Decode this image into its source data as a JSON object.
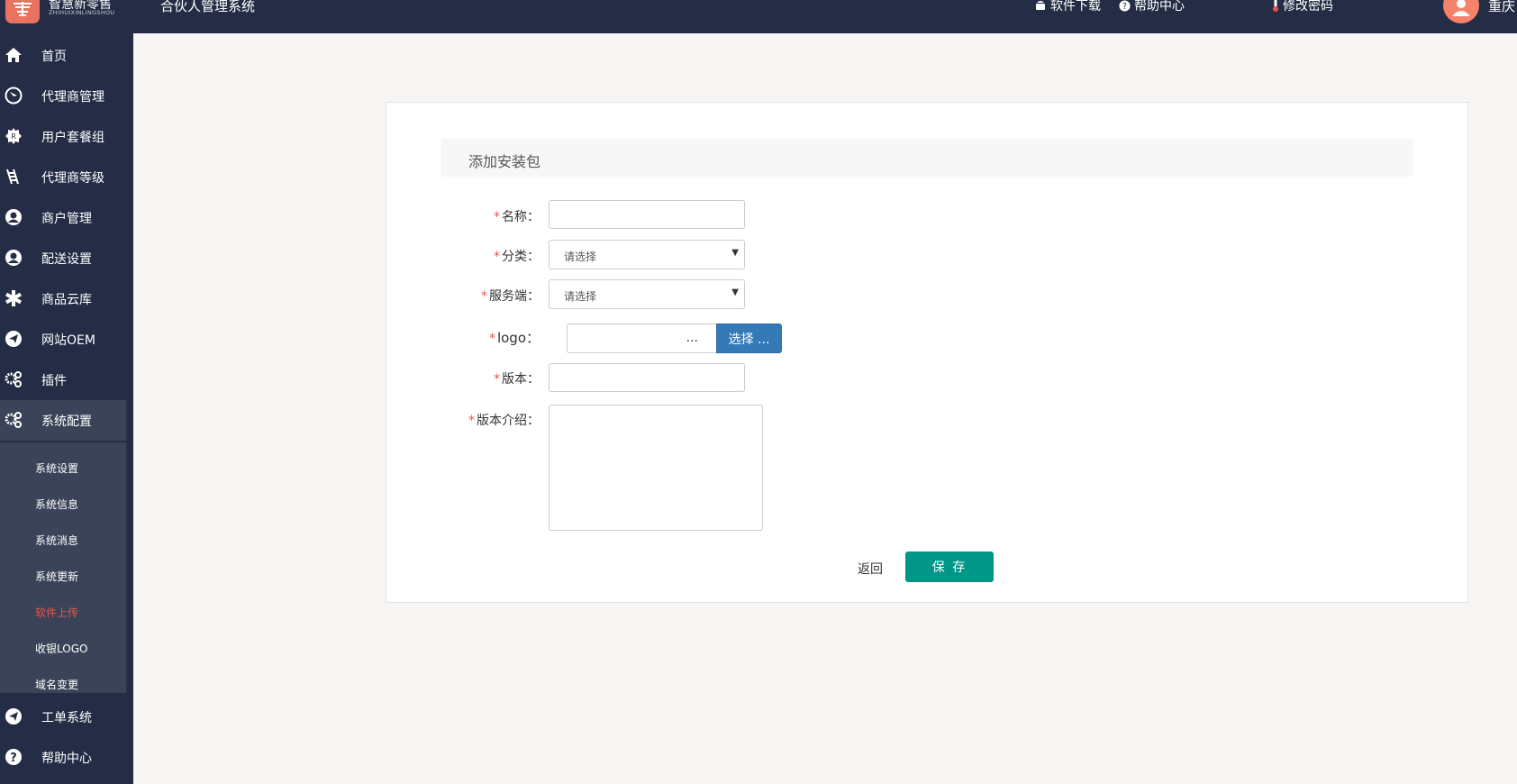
{
  "header": {
    "logo_cn": "智慧新零售",
    "logo_en": "ZHIHUIXINLINGSHOU",
    "app_title": "合伙人管理系统",
    "links": [
      {
        "label": "软件下载",
        "icon": "android-icon"
      },
      {
        "label": "帮助中心",
        "icon": "question-circle-icon"
      },
      {
        "label": "修改密码",
        "icon": "thermometer-icon"
      }
    ],
    "user_name": "重庆"
  },
  "sidebar": {
    "items": [
      {
        "label": "首页",
        "icon": "home-icon"
      },
      {
        "label": "代理商管理",
        "icon": "compass-icon"
      },
      {
        "label": "用户套餐组",
        "icon": "badge-icon"
      },
      {
        "label": "代理商等级",
        "icon": "ladder-icon"
      },
      {
        "label": "商户管理",
        "icon": "user-circle-icon"
      },
      {
        "label": "配送设置",
        "icon": "user-circle-icon"
      },
      {
        "label": "商品云库",
        "icon": "asterisk-icon"
      },
      {
        "label": "网站OEM",
        "icon": "paper-plane-icon"
      },
      {
        "label": "插件",
        "icon": "gears-icon"
      },
      {
        "label": "系统配置",
        "icon": "gears-icon"
      },
      {
        "label": "工单系统",
        "icon": "paper-plane-icon"
      },
      {
        "label": "帮助中心",
        "icon": "question-circle-icon"
      }
    ],
    "submenu": [
      {
        "label": "系统设置"
      },
      {
        "label": "系统信息"
      },
      {
        "label": "系统消息"
      },
      {
        "label": "系统更新"
      },
      {
        "label": "软件上传"
      },
      {
        "label": "收银LOGO"
      },
      {
        "label": "域名变更"
      }
    ],
    "active_color": "#e8544c"
  },
  "form": {
    "title": "添加安装包",
    "required_mark": "*",
    "name_label": "名称：",
    "category_label": "分类：",
    "category_value": "请选择",
    "server_label": "服务端：",
    "server_value": "请选择",
    "logo_label": "logo：",
    "logo_dots": "...",
    "logo_button": "选择 ...",
    "version_label": "版本：",
    "intro_label": "版本介绍：",
    "back_label": "返回",
    "save_label": "保 存"
  },
  "colors": {
    "nav_bg": "#242d45",
    "primary_button": "#337ab7",
    "save_button": "#009688"
  }
}
